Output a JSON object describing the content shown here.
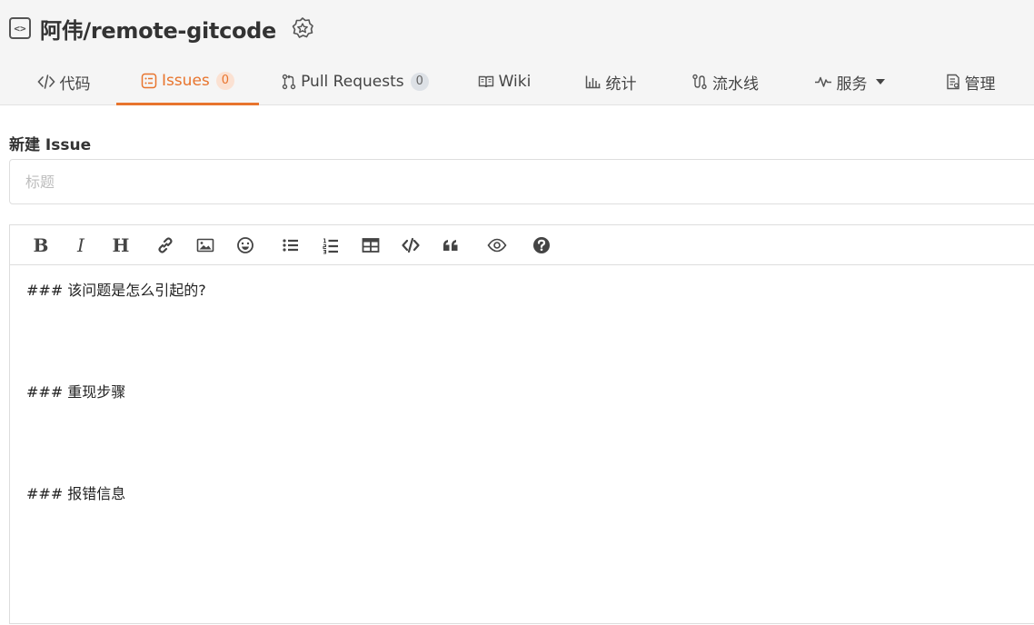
{
  "repo": {
    "name": "阿伟/remote-gitcode",
    "icon": "code-icon",
    "badge_icon": "award-badge-icon"
  },
  "tabs": [
    {
      "label": "代码",
      "icon": "code-icon"
    },
    {
      "label": "Issues",
      "count": "0",
      "icon": "issues-icon",
      "active": true
    },
    {
      "label": "Pull Requests",
      "count": "0",
      "icon": "pull-request-icon"
    },
    {
      "label": "Wiki",
      "icon": "wiki-icon"
    },
    {
      "label": "统计",
      "icon": "chart-icon"
    },
    {
      "label": "流水线",
      "icon": "pipeline-icon"
    },
    {
      "label": "服务",
      "icon": "service-icon",
      "has_dropdown": true
    },
    {
      "label": "管理",
      "icon": "manage-icon"
    }
  ],
  "form": {
    "title": "新建 Issue",
    "title_placeholder": "标题",
    "title_value": ""
  },
  "editor": {
    "toolbar": [
      "bold",
      "italic",
      "heading",
      "link",
      "image",
      "emoji",
      "unordered-list",
      "ordered-list",
      "table",
      "code",
      "quote",
      "preview",
      "help"
    ],
    "lines": [
      "### 该问题是怎么引起的?",
      "### 重现步骤",
      "### 报错信息"
    ]
  },
  "colors": {
    "accent": "#e8742d",
    "count_bg": "#dde1e6",
    "active_count_bg": "#fbe1d2"
  }
}
